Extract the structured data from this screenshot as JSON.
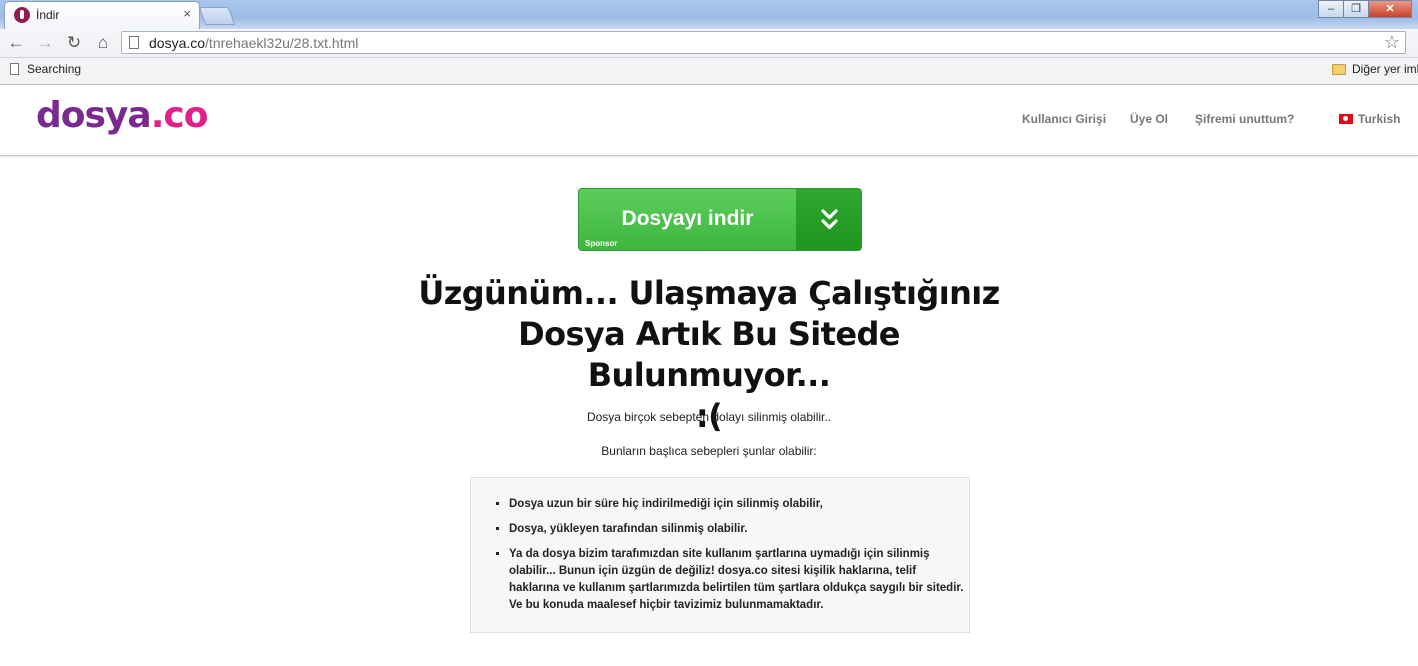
{
  "browser": {
    "tab_title": "İndir",
    "tab_close": "×",
    "url_domain": "dosya.co",
    "url_path": "/tnrehaekl32u/28.txt.html",
    "bookmarks": {
      "item1": "Searching",
      "item2": "Diğer yer imleri"
    },
    "window_buttons": {
      "minimize": "–",
      "maximize": "❐",
      "close": "✕"
    },
    "nav": {
      "back": "←",
      "forward": "→",
      "reload": "↻",
      "home": "⌂",
      "star": "☆"
    }
  },
  "site": {
    "logo_left": "dosya",
    "logo_dot": ".co",
    "nav": {
      "login": "Kullanıcı Girişi",
      "signup": "Üye Ol",
      "forgot": "Şifremi unuttum?",
      "language": "Turkish"
    }
  },
  "download": {
    "label": "Dosyayı indir",
    "sponsor": "Sponsor"
  },
  "message": {
    "line1": "Üzgünüm... Ulaşmaya Çalıştığınız",
    "line2": "Dosya Artık Bu Sitede Bulunmuyor...",
    "line3": ":(",
    "sub1": "Dosya birçok sebepten dolayı silinmiş olabilir..",
    "sub2": "Bunların başlıca sebepleri şunlar olabilir:"
  },
  "reasons": [
    "Dosya uzun bir süre hiç indirilmediği için silinmiş olabilir,",
    "Dosya, yükleyen tarafından silinmiş olabilir.",
    "Ya da dosya bizim tarafımızdan site kullanım şartlarına uymadığı için silinmiş olabilir... Bunun için üzgün de değiliz! dosya.co sitesi kişilik haklarına, telif haklarına ve kullanım şartlarımızda belirtilen tüm şartlara oldukça saygılı bir sitedir. Ve bu konuda maalesef hiçbir tavizimiz bulunmamaktadır."
  ],
  "colors": {
    "brand_purple": "#7a2a8e",
    "brand_pink": "#e0218a",
    "download_green": "#4cc24c"
  }
}
